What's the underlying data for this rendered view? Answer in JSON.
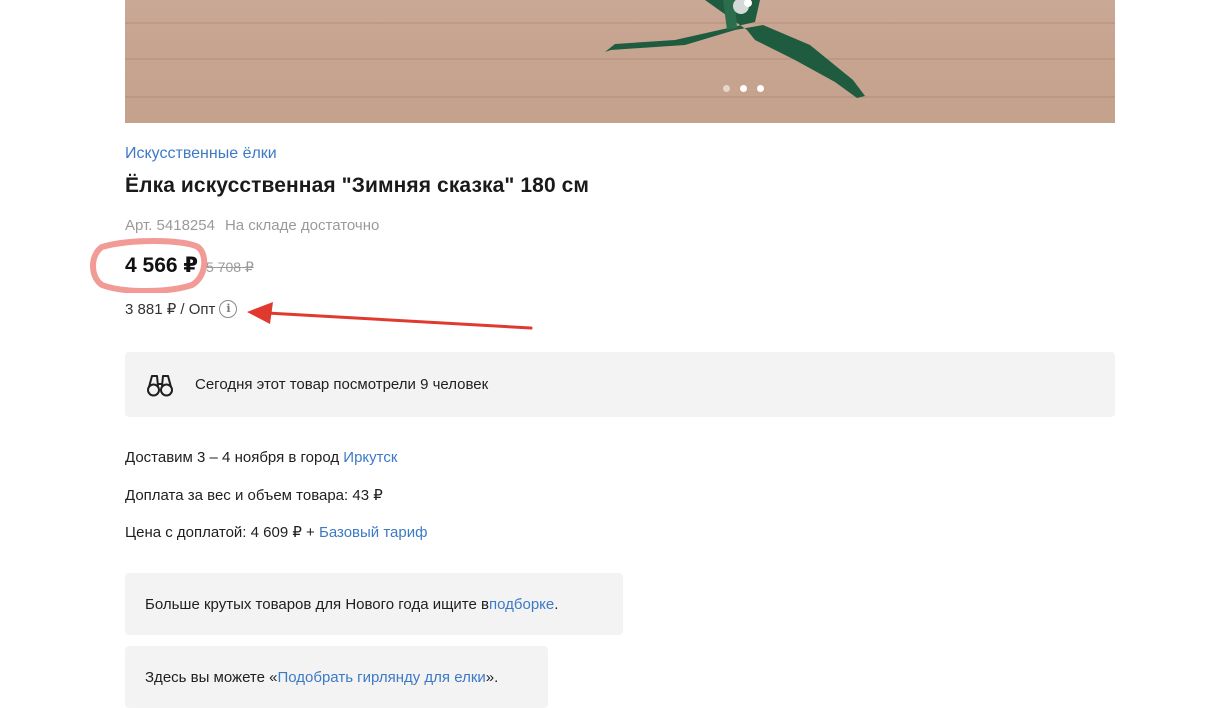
{
  "gallery": {
    "dots": [
      false,
      true,
      true
    ]
  },
  "product": {
    "category": "Искусственные ёлки",
    "title": "Ёлка искусственная \"Зимняя сказка\" 180 см",
    "article": "Арт. 5418254",
    "stock": "На складе достаточно",
    "price": "4 566 ₽",
    "old_price": "5 708 ₽",
    "wholesale": "3 881 ₽ / Опт"
  },
  "views": {
    "text": "Сегодня этот товар посмотрели 9 человек"
  },
  "delivery": {
    "prefix": "Доставим 3 – 4 ноября в город ",
    "city": "Иркутск",
    "surcharge": "Доплата за вес и объем товара: 43 ₽",
    "total_prefix": "Цена с доплатой: 4 609 ₽ + ",
    "tariff": "Базовый тариф"
  },
  "promos": {
    "collection_prefix": "Больше крутых товаров для Нового года ищите в ",
    "collection_link": "подборке",
    "collection_suffix": ".",
    "garland_prefix": "Здесь вы можете «",
    "garland_link": "Подобрать гирлянду для елки",
    "garland_suffix": "»."
  },
  "colors": {
    "link": "#3d7ac5",
    "annotation_ring": "#f08a84",
    "annotation_arrow": "#e03a2f",
    "info_box_bg": "#f3f3f3"
  },
  "icons": {
    "binoculars": "binoculars-icon",
    "info": "info-icon"
  }
}
